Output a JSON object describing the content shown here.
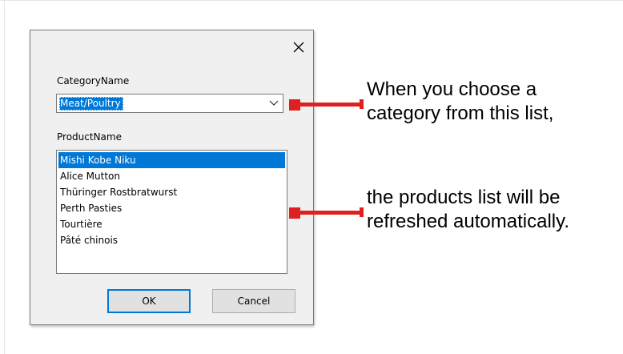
{
  "dialog": {
    "close_glyph": "✕",
    "category_label": "CategoryName",
    "category_value": "Meat/Poultry",
    "product_label": "ProductName",
    "products": [
      {
        "name": "Mishi Kobe Niku",
        "selected": true
      },
      {
        "name": "Alice Mutton",
        "selected": false
      },
      {
        "name": "Thüringer Rostbratwurst",
        "selected": false
      },
      {
        "name": "Perth Pasties",
        "selected": false
      },
      {
        "name": "Tourtière",
        "selected": false
      },
      {
        "name": "Pâté chinois",
        "selected": false
      }
    ],
    "ok_label": "OK",
    "cancel_label": "Cancel"
  },
  "annotations": {
    "note_top_line1": "When you choose a",
    "note_top_line2": "category from this list,",
    "note_bottom_line1": "the products list will be",
    "note_bottom_line2": "refreshed automatically."
  },
  "colors": {
    "accent": "#0078d7",
    "connector": "#e02020",
    "dialog_bg": "#f0f0f0"
  },
  "icons": {
    "close": "close-icon",
    "dropdown": "chevron-down-icon"
  }
}
